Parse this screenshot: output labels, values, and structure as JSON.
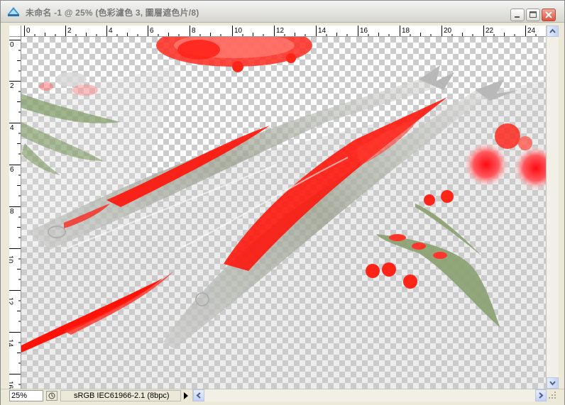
{
  "window": {
    "title": "未命名 -1 @ 25% (色彩濾色 3, 圖層遮色片/8)",
    "app_icon": "photoshop-document-icon",
    "buttons": {
      "minimize_icon": "minimize-icon",
      "maximize_icon": "maximize-icon",
      "close_icon": "close-icon"
    }
  },
  "rulers": {
    "horizontal_labels": [
      "0",
      "2",
      "4",
      "6",
      "8",
      "10",
      "12",
      "14",
      "16",
      "18",
      "20",
      "22",
      "24"
    ],
    "vertical_labels": [
      "0",
      "2",
      "4",
      "6",
      "8",
      "10",
      "12",
      "14",
      "16"
    ]
  },
  "canvas": {
    "description_colors": {
      "checker_light": "#ffffff",
      "checker_dark": "#cccccc",
      "accent_red": "#ff1a10",
      "accent_green": "#6f8f5a"
    }
  },
  "status": {
    "zoom": "25%",
    "document_profile": "sRGB IEC61966-2.1 (8bpc)"
  }
}
